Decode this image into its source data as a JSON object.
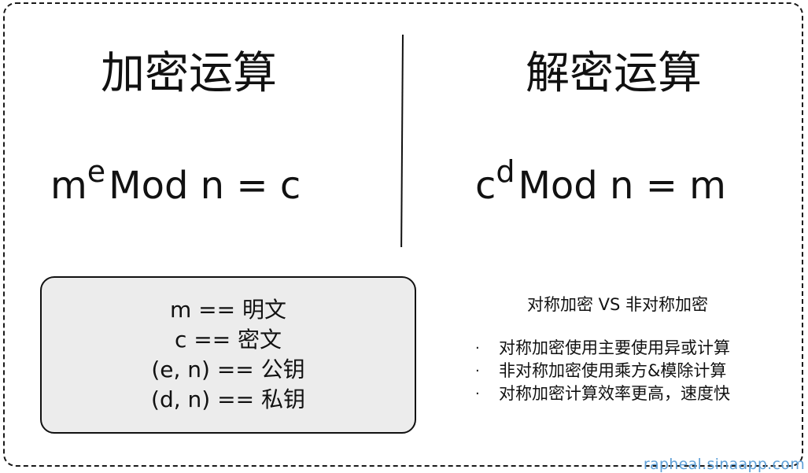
{
  "encryption": {
    "title": "加密运算",
    "formula": {
      "base": "m",
      "exponent": "e",
      "rest": "Mod n = c"
    }
  },
  "decryption": {
    "title": "解密运算",
    "formula": {
      "base": "c",
      "exponent": "d",
      "rest": "Mod n = m"
    }
  },
  "legend": {
    "items": [
      "m == 明文",
      "c == 密文",
      "(e, n) == 公钥",
      "(d, n) == 私钥"
    ]
  },
  "comparison": {
    "title": "对称加密 VS 非对称加密",
    "bullet": "·",
    "points": [
      "对称加密使用主要使用异或计算",
      "非对称加密使用乘方&模除计算",
      "对称加密计算效率更高，速度快"
    ]
  },
  "watermark": "rapheal.sinaapp.com",
  "colors": {
    "watermark": "#5fa0d8",
    "legend_fill": "#ececec",
    "stroke": "#111111"
  }
}
